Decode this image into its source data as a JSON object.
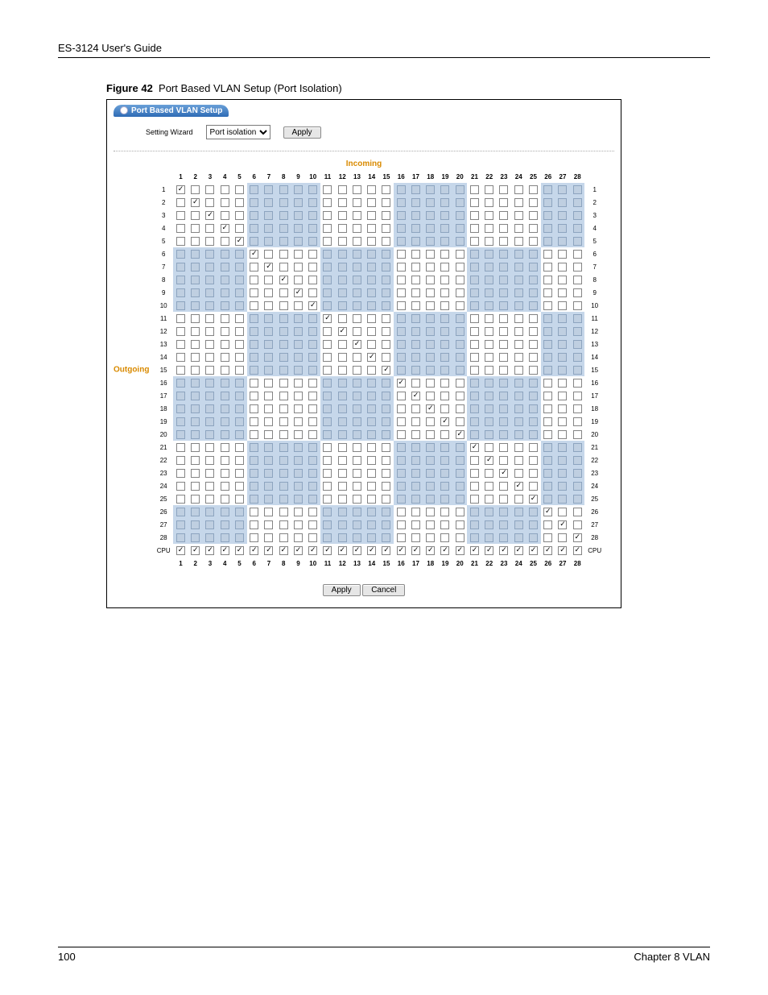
{
  "doc": {
    "guide_title": "ES-3124 User's Guide",
    "figure_label": "Figure 42",
    "figure_caption": "Port Based VLAN Setup (Port Isolation)",
    "page_number": "100",
    "chapter": "Chapter 8 VLAN"
  },
  "ui": {
    "title": "Port Based VLAN Setup",
    "wizard_label": "Setting Wizard",
    "wizard_option": "Port isolation",
    "apply_top": "Apply",
    "incoming_label": "Incoming",
    "outgoing_label": "Outgoing",
    "apply_bottom": "Apply",
    "cancel_bottom": "Cancel",
    "cpu_label": "CPU",
    "num_cols": 28,
    "num_rows": 28
  }
}
